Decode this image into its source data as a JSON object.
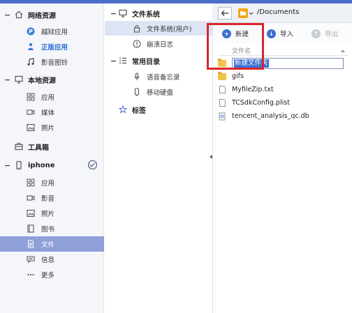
{
  "sidebar": {
    "sections": [
      {
        "label": "网络资源",
        "items": [
          "越狱应用",
          "正版应用",
          "影音图铃"
        ]
      },
      {
        "label": "本地资源",
        "items": [
          "应用",
          "媒体",
          "照片"
        ]
      },
      {
        "label": "工具箱"
      },
      {
        "label": "iphone",
        "items": [
          "应用",
          "影音",
          "照片",
          "图书",
          "文件",
          "信息",
          "更多"
        ]
      }
    ]
  },
  "tree": {
    "file_system": "文件系统",
    "file_system_user": "文件系统(用户)",
    "crash_log": "崩溃日志",
    "common_dirs": "常用目录",
    "voice_memo": "语音备忘录",
    "mobile_disk": "移动硬盘",
    "bookmarks": "标签"
  },
  "navbar": {
    "path": "/Documents"
  },
  "toolbar": {
    "new_label": "新建",
    "import_label": "导入",
    "export_label": "导出"
  },
  "file_list": {
    "column_header": "文件名",
    "editing_name": "新建文件夹",
    "files": [
      {
        "name": "gifs",
        "type": "folder"
      },
      {
        "name": "MyfileZip.txt",
        "type": "file"
      },
      {
        "name": "TCSdkConfig.plist",
        "type": "file"
      },
      {
        "name": "tencent_analysis_qc.db",
        "type": "db"
      }
    ]
  },
  "colors": {
    "accent": "#4b6fc9",
    "selected": "#8fa0d9",
    "highlight": "#d9262b"
  }
}
